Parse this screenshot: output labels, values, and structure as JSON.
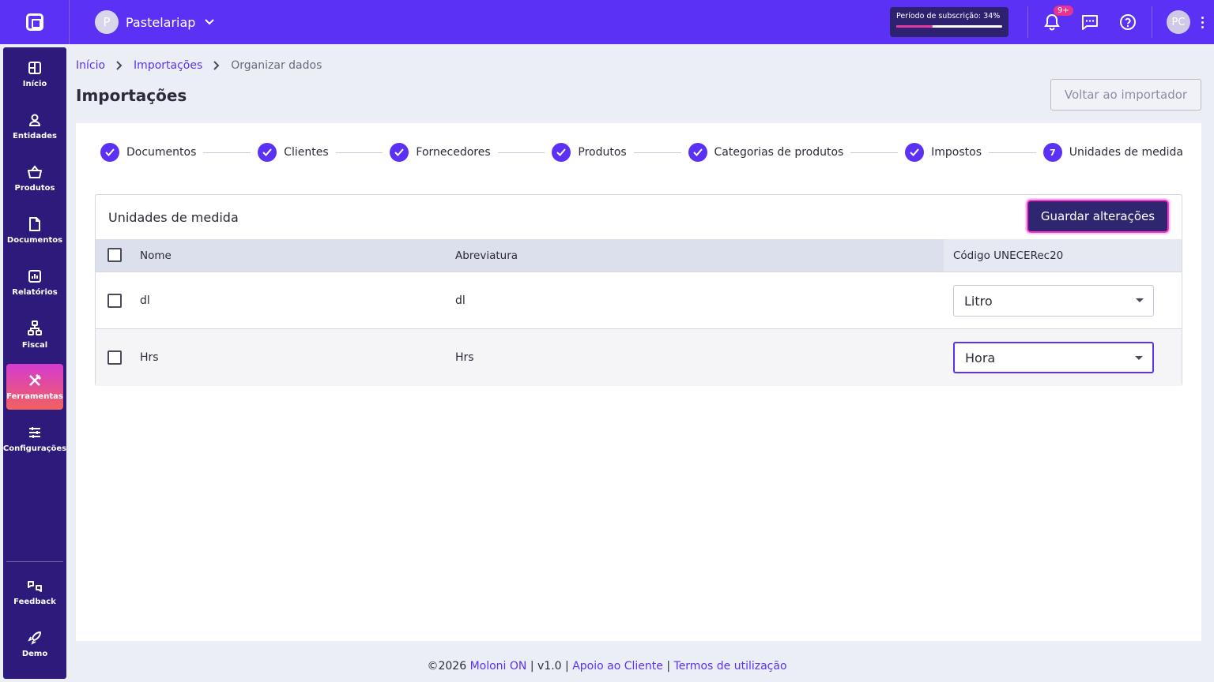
{
  "topbar": {
    "company_initial": "P",
    "company_name": "Pastelariap",
    "subscription_label": "Período de subscrição: 34%",
    "subscription_progress": 0.34,
    "notifications_badge": "9+",
    "user_initials": "PC"
  },
  "sidebar": {
    "items": [
      {
        "label": "Início",
        "icon": "grid-icon"
      },
      {
        "label": "Entidades",
        "icon": "person-icon"
      },
      {
        "label": "Produtos",
        "icon": "basket-icon"
      },
      {
        "label": "Documentos",
        "icon": "document-icon"
      },
      {
        "label": "Relatórios",
        "icon": "chart-icon"
      },
      {
        "label": "Fiscal",
        "icon": "fiscal-icon"
      },
      {
        "label": "Ferramentas",
        "icon": "tools-icon"
      },
      {
        "label": "Configurações",
        "icon": "sliders-icon"
      },
      {
        "label": "Feedback",
        "icon": "feedback-icon"
      },
      {
        "label": "Demo",
        "icon": "rocket-icon"
      }
    ],
    "active": "Ferramentas"
  },
  "breadcrumb": {
    "items": [
      "Início",
      "Importações",
      "Organizar dados"
    ]
  },
  "page": {
    "title": "Importações",
    "back_button": "Voltar ao importador"
  },
  "stepper": {
    "steps": [
      {
        "label": "Documentos",
        "done": true
      },
      {
        "label": "Clientes",
        "done": true
      },
      {
        "label": "Fornecedores",
        "done": true
      },
      {
        "label": "Produtos",
        "done": true
      },
      {
        "label": "Categorias de produtos",
        "done": true
      },
      {
        "label": "Impostos",
        "done": true
      },
      {
        "label": "Unidades de medida",
        "done": false,
        "number": "7"
      }
    ]
  },
  "card": {
    "title": "Unidades de medida",
    "save_button": "Guardar alterações",
    "columns": {
      "name": "Nome",
      "abbr": "Abreviatura",
      "code": "Código UNECERec20"
    },
    "rows": [
      {
        "name": "dl",
        "abbr": "dl",
        "code": "Litro"
      },
      {
        "name": "Hrs",
        "abbr": "Hrs",
        "code": "Hora"
      }
    ]
  },
  "footer": {
    "copyright": "©2026",
    "brand": "Moloni ON",
    "sep1": "|",
    "version": "v1.0",
    "sep2": "|",
    "support": "Apoio ao Cliente",
    "sep3": "|",
    "terms": "Termos de utilização"
  },
  "colors": {
    "primary": "#5b32f5",
    "sidebar": "#2e1a7a",
    "save_button": "#2e2670",
    "highlight": "#ff33cc"
  }
}
